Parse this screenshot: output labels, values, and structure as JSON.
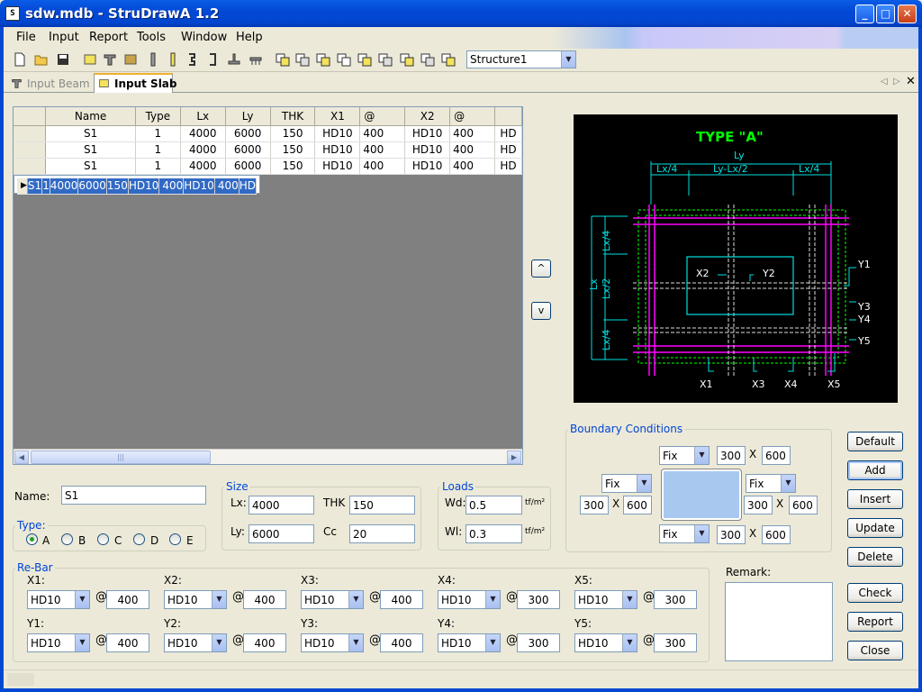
{
  "window": {
    "title": "sdw.mdb - StruDrawA 1.2",
    "icon": "app-icon"
  },
  "menu": [
    "File",
    "Input",
    "Report",
    "Tools",
    "Window",
    "Help"
  ],
  "toolbar": {
    "structure": "Structure1"
  },
  "tabs": [
    {
      "label": "Input Beam",
      "active": false
    },
    {
      "label": "Input Slab",
      "active": true
    }
  ],
  "grid": {
    "columns": [
      "Name",
      "Type",
      "Lx",
      "Ly",
      "THK",
      "X1",
      "@",
      "X2",
      "@",
      ""
    ],
    "rows": [
      [
        "S1",
        "1",
        "4000",
        "6000",
        "150",
        "HD10",
        "400",
        "HD10",
        "400",
        "HD"
      ],
      [
        "S1",
        "1",
        "4000",
        "6000",
        "150",
        "HD10",
        "400",
        "HD10",
        "400",
        "HD"
      ],
      [
        "S1",
        "1",
        "4000",
        "6000",
        "150",
        "HD10",
        "400",
        "HD10",
        "400",
        "HD"
      ],
      [
        "S1",
        "1",
        "4000",
        "6000",
        "150",
        "HD10",
        "400",
        "HD10",
        "400",
        "HD"
      ]
    ],
    "selected_row": 3
  },
  "nav": {
    "up": "^",
    "down": "v"
  },
  "diagram": {
    "title": "TYPE \"A\"",
    "ly": "Ly",
    "lx4_left": "Lx/4",
    "ly_mid": "Ly-Lx/2",
    "lx4_right": "Lx/4",
    "lx": "Lx",
    "lx4a": "Lx/4",
    "lx2": "Lx/2",
    "lx4b": "Lx/4",
    "x1": "X1",
    "x2": "X2",
    "x3": "X3",
    "x4": "X4",
    "x5": "X5",
    "y1": "Y1",
    "y2": "Y2",
    "y3": "Y3",
    "y4": "Y4",
    "y5": "Y5"
  },
  "form": {
    "name_label": "Name:",
    "name": "S1",
    "type_legend": "Type:",
    "types": [
      "A",
      "B",
      "C",
      "D",
      "E"
    ],
    "type_selected": "A",
    "size_legend": "Size",
    "lx_label": "Lx:",
    "lx": "4000",
    "ly_label": "Ly:",
    "ly": "6000",
    "thk_label": "THK",
    "thk": "150",
    "cc_label": "Cc",
    "cc": "20",
    "loads_legend": "Loads",
    "wd_label": "Wd:",
    "wd": "0.5",
    "wl_label": "Wl:",
    "wl": "0.3",
    "unit": "tf/m²"
  },
  "boundary": {
    "legend": "Boundary Conditions",
    "top": {
      "type": "Fix",
      "a": "300",
      "b": "600"
    },
    "left": {
      "type": "Fix",
      "a": "300",
      "b": "600"
    },
    "right": {
      "type": "Fix",
      "a": "300",
      "b": "600"
    },
    "bottom": {
      "type": "Fix",
      "a": "300",
      "b": "600"
    },
    "x": "X"
  },
  "rebar": {
    "legend": "Re-Bar",
    "at": "@",
    "items": [
      {
        "label": "X1:",
        "bar": "HD10",
        "spacing": "400"
      },
      {
        "label": "X2:",
        "bar": "HD10",
        "spacing": "400"
      },
      {
        "label": "X3:",
        "bar": "HD10",
        "spacing": "400"
      },
      {
        "label": "X4:",
        "bar": "HD10",
        "spacing": "300"
      },
      {
        "label": "X5:",
        "bar": "HD10",
        "spacing": "300"
      },
      {
        "label": "Y1:",
        "bar": "HD10",
        "spacing": "400"
      },
      {
        "label": "Y2:",
        "bar": "HD10",
        "spacing": "400"
      },
      {
        "label": "Y3:",
        "bar": "HD10",
        "spacing": "400"
      },
      {
        "label": "Y4:",
        "bar": "HD10",
        "spacing": "300"
      },
      {
        "label": "Y5:",
        "bar": "HD10",
        "spacing": "300"
      }
    ]
  },
  "remark_label": "Remark:",
  "buttons": {
    "default": "Default",
    "add": "Add",
    "insert": "Insert",
    "update": "Update",
    "delete": "Delete",
    "check": "Check",
    "report": "Report",
    "close": "Close"
  }
}
